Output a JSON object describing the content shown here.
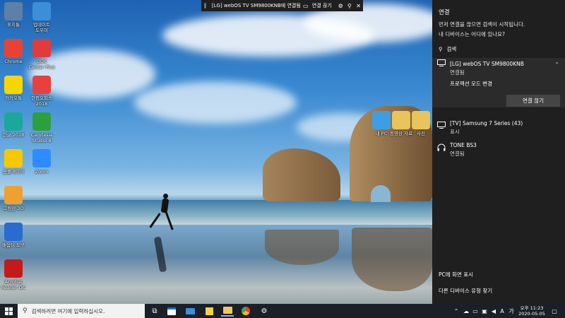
{
  "desktop": {
    "icons_left": [
      {
        "label": "휴지통",
        "icon": "recycle-bin-icon",
        "color": "#5f7ea8"
      },
      {
        "label": "Chrome",
        "icon": "chrome-icon",
        "color": "#e94235"
      },
      {
        "label": "카카오톡",
        "icon": "kakaotalk-icon",
        "color": "#f7d600"
      },
      {
        "label": "한글 2018",
        "icon": "hangul-icon",
        "color": "#1aa89a"
      },
      {
        "label": "곰플레이어",
        "icon": "gom-player-icon",
        "color": "#f6c800"
      },
      {
        "label": "그림판 3D",
        "icon": "paint-3d-icon",
        "color": "#f0a030"
      },
      {
        "label": "배움터 도구",
        "icon": "helper-tool-icon",
        "color": "#2a6bd0"
      },
      {
        "label": "Acrobat\nReader DC",
        "icon": "acrobat-reader-icon",
        "color": "#c61a1a"
      }
    ],
    "icons_second": [
      {
        "label": "업데이트\n도우미",
        "icon": "update-assistant-icon",
        "color": "#3a8fd8"
      },
      {
        "label": "DDS\nCenter Plus",
        "icon": "dds-center-icon",
        "color": "#e23b3b"
      },
      {
        "label": "한컴오피스\n2018",
        "icon": "hancom-office-icon",
        "color": "#e8403e"
      },
      {
        "label": "Camtasia\nStudio 8",
        "icon": "camtasia-icon",
        "color": "#2e9f3e"
      },
      {
        "label": "Zoom",
        "icon": "zoom-icon",
        "color": "#2d8cff"
      }
    ],
    "icons_mid": [
      {
        "label": "내 PC",
        "icon": "this-pc-icon",
        "color": "#3d9ee6"
      },
      {
        "label": "동영상 자료",
        "icon": "folder-icon",
        "color": "#e8c45a"
      },
      {
        "label": "사진",
        "icon": "folder-icon",
        "color": "#e8c45a"
      }
    ]
  },
  "castbar": {
    "title": "[LG] webOS TV SM9800KNB에 연결됨",
    "disconnect_label": "연결 끊기"
  },
  "panel": {
    "header": "연결",
    "message": "먼저 연결을 끊으면 검색이 시작됩니다.\n내 디바이스는 어디에 있나요?",
    "search_label": "검색",
    "devices": [
      {
        "name": "[LG] webOS TV SM9800KNB",
        "status": "연결됨",
        "icon": "tv-icon"
      },
      {
        "name": "[TV] Samsung 7 Series (43)",
        "status": "표시",
        "icon": "tv-icon"
      },
      {
        "name": "TONE BS3",
        "status": "연결됨",
        "icon": "headphones-icon"
      }
    ],
    "projection_mode_label": "프로젝션 모드 변경",
    "disconnect_button_label": "연결 끊기",
    "footer_project": "PC에 화면 표시",
    "footer_find": "다른 디바이스 유형 찾기"
  },
  "taskbar": {
    "search_placeholder": "검색하려면 여기에 입력하십시오.",
    "tray_ime": "A",
    "tray_lang": "가",
    "clock_time": "오후 11:23",
    "clock_date": "2020-05-05"
  },
  "colors": {
    "accent": "#2d8cff",
    "panel_bg": "#1f1f1f",
    "taskbar_bg": "#1a1f28"
  }
}
